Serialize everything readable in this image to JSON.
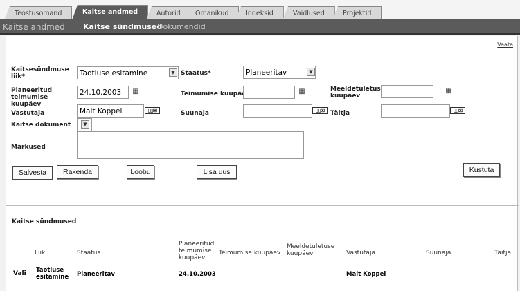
{
  "tabs": [
    {
      "label": "Teostusomand",
      "active": false
    },
    {
      "label": "Kaitse andmed",
      "active": true
    },
    {
      "label": "Autorid",
      "active": false
    },
    {
      "label": "Omanikud",
      "active": false
    },
    {
      "label": "Indeksid",
      "active": false
    },
    {
      "label": "Vaidlused",
      "active": false
    },
    {
      "label": "Projektid",
      "active": false
    }
  ],
  "subnav": {
    "title": "Kaitse andmed",
    "items": [
      {
        "label": "Kaitse sündmused",
        "active": true
      },
      {
        "label": "Dokumendid",
        "active": false
      }
    ]
  },
  "top_link": "Vaata",
  "form": {
    "type_label": "Kaitsesündmuse liik*",
    "type_value": "Taotluse esitamine",
    "status_label": "Staatus*",
    "status_value": "Planeeritav",
    "planned_date_label": "Planeeritud teimumise kuupäev",
    "planned_date_value": "24.10.2003",
    "occurred_date_label": "Teimumise kuupäev",
    "occurred_date_value": "",
    "reminder_date_label": "Meeldetuletuse kuupäev",
    "reminder_date_value": "",
    "responsible_label": "Vastutaja",
    "responsible_value": "Mait Koppel",
    "director_label": "Suunaja",
    "director_value": "",
    "executor_label": "Täitja",
    "executor_value": "",
    "document_label": "Kaitse dokument",
    "notes_label": "Märkused",
    "notes_value": ""
  },
  "buttons": {
    "save": "Salvesta",
    "apply": "Rakenda",
    "cancel": "Loobu",
    "add_new": "Lisa uus",
    "delete": "Kustuta"
  },
  "events": {
    "section_title": "Kaitse sündmused",
    "columns": [
      "Liik",
      "Staatus",
      "Planeeritud teimumise kuupäev",
      "Teimumise kuupäev",
      "Meeldetuletuse kuupäev",
      "Vastutaja",
      "Suunaja",
      "Täitja"
    ],
    "rows": [
      {
        "action": "Vali",
        "type": "Taotluse esitamine",
        "status": "Planeeritav",
        "planned": "24.10.2003",
        "occurred": "",
        "reminder": "",
        "responsible": "Mait Koppel",
        "director": "",
        "executor": ""
      }
    ]
  }
}
